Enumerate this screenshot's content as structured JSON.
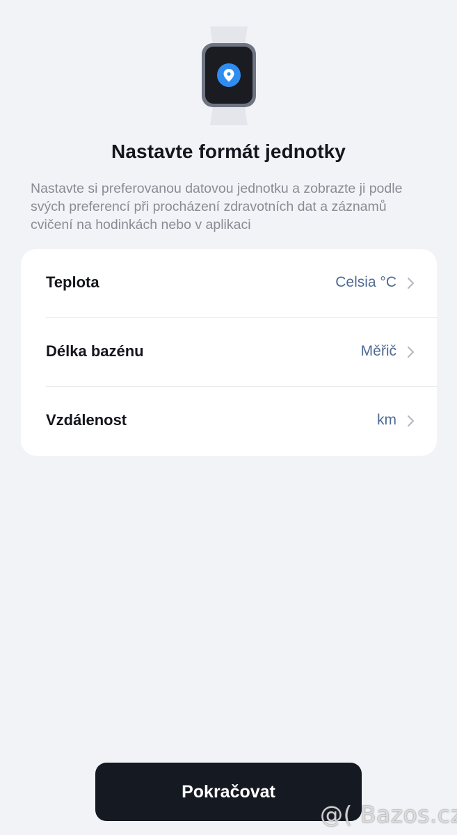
{
  "header": {
    "title": "Nastavte formát jednotky",
    "description": "Nastavte si preferovanou datovou jednotku a zobrazte ji podle svých preferencí při procházení zdravotních dat a záznamů cvičení na hodinkách nebo v aplikaci"
  },
  "settings": {
    "items": [
      {
        "label": "Teplota",
        "value": "Celsia °C"
      },
      {
        "label": "Délka bazénu",
        "value": "Měřič"
      },
      {
        "label": "Vzdálenost",
        "value": "km"
      }
    ]
  },
  "actions": {
    "continue_label": "Pokračovat"
  },
  "watermark": {
    "text": "@( Bazos.cz"
  },
  "colors": {
    "background": "#f2f3f7",
    "card": "#ffffff",
    "value_text": "#4f6a92",
    "button": "#151922",
    "accent": "#2f8cf0"
  },
  "icons": {
    "illustration": "smartwatch-location-pin-icon",
    "row_chevron": "chevron-right-icon"
  }
}
